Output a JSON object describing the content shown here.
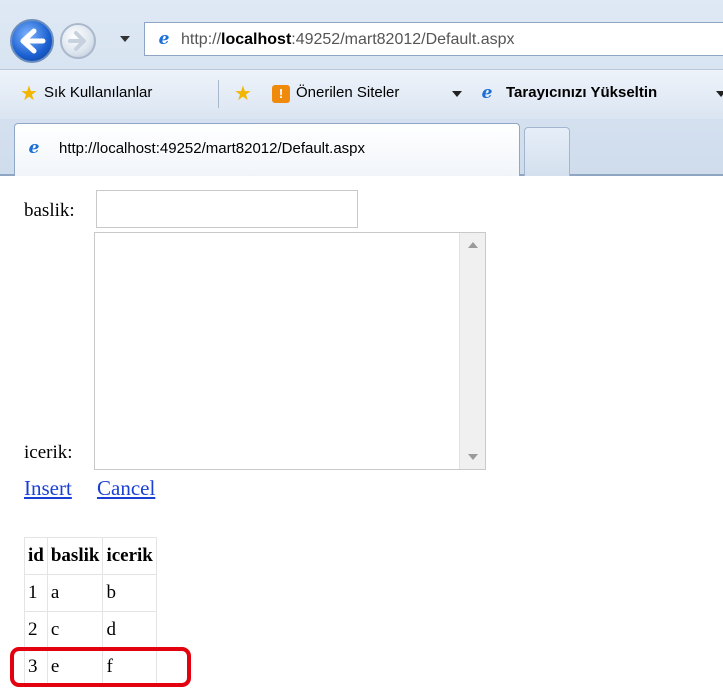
{
  "browser": {
    "url_prefix": "http://",
    "url_host": "localhost",
    "url_rest": ":49252/mart82012/Default.aspx",
    "tab_title": "http://localhost:49252/mart82012/Default.aspx",
    "favorites": {
      "favorites_label": "Sık Kullanılanlar",
      "suggested_sites_label": "Önerilen Siteler",
      "upgrade_browser_label": "Tarayıcınızı Yükseltin"
    }
  },
  "form": {
    "baslik_label": "baslik:",
    "baslik_value": "",
    "icerik_label": "icerik:",
    "icerik_value": "",
    "insert_label": "Insert",
    "cancel_label": "Cancel"
  },
  "table": {
    "columns": [
      "id",
      "baslik",
      "icerik"
    ],
    "rows": [
      [
        "1",
        "a",
        "b"
      ],
      [
        "2",
        "c",
        "d"
      ],
      [
        "3",
        "e",
        "f"
      ]
    ]
  },
  "colors": {
    "link": "#1a3fd4",
    "highlight": "#e3000f"
  },
  "icons": {
    "back": "back-arrow-icon",
    "forward": "forward-arrow-icon",
    "ie": "internet-explorer-icon",
    "star": "star-icon"
  }
}
